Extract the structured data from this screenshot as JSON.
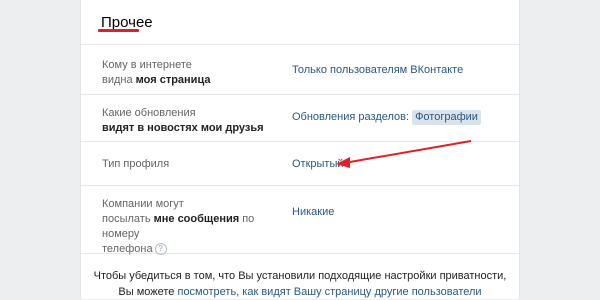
{
  "section": {
    "title": "Прочее"
  },
  "rows": [
    {
      "label_pre": "Кому в интернете",
      "label_line2_pre": "видна ",
      "label_line2_bold": "моя страница",
      "value": "Только пользователям ВКонтакте"
    },
    {
      "label_pre": "Какие обновления",
      "label_line2_pre": "",
      "label_line2_bold": "видят в новостях мои друзья",
      "value": "Обновления разделов:",
      "chip": "Фотографии"
    },
    {
      "label_pre": "Тип профиля",
      "value": "Открытый"
    },
    {
      "label_line1": "Компании могут",
      "label_line2_pre": "посылать ",
      "label_line2_bold": "мне сообщения",
      "label_line2_post": " по номеру",
      "label_line3": "телефона",
      "help": "?",
      "value": "Никакие"
    }
  ],
  "footer": {
    "line1": "Чтобы убедиться в том, что Вы установили подходящие настройки приватности,",
    "line2_pre": "Вы можете ",
    "line2_link": "посмотреть, как видят Вашу страницу другие пользователи"
  },
  "colors": {
    "accent": "#2a5885",
    "annotation": "#e21f26"
  }
}
